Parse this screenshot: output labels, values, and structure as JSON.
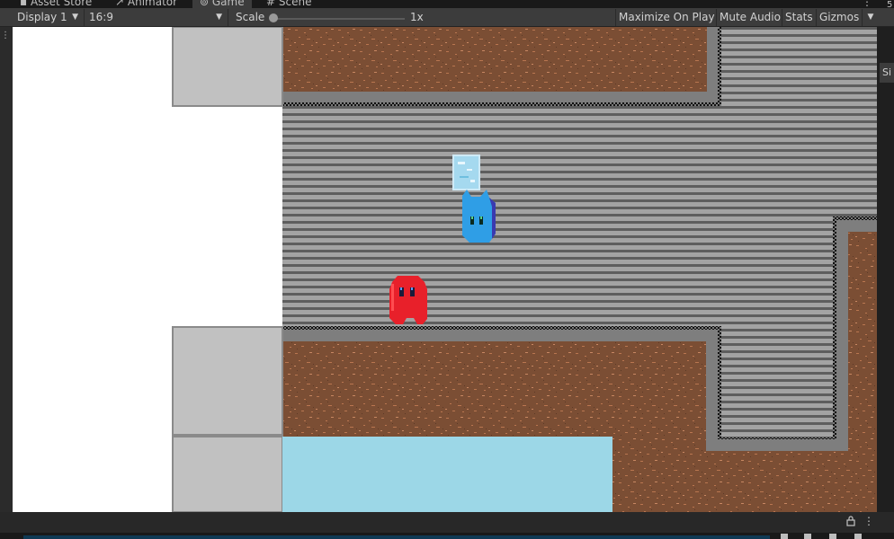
{
  "editor": {
    "tabs": [
      {
        "label": "Asset Store",
        "icon": "asset-store-icon"
      },
      {
        "label": "Animator",
        "icon": "animator-icon"
      },
      {
        "label": "Game",
        "icon": "game-controller-icon",
        "active": true
      },
      {
        "label": "Scene",
        "icon": "scene-grid-icon"
      }
    ],
    "toolbar": {
      "display": "Display 1",
      "aspect": "16:9",
      "scale_label": "Scale",
      "scale_value": "1x",
      "scale_level": 0.0,
      "maximize_label": "Maximize On Play",
      "mute_label": "Mute Audio",
      "stats_label": "Stats",
      "gizmos_label": "Gizmos"
    },
    "side_tab_label": "Si",
    "colors": {
      "editor_bg": "#191919",
      "toolbar_bg": "#3c3c3c",
      "dirt": "#7b4e34",
      "dirt_speck": "#b97650",
      "stone": "#7e7e7e",
      "stripes_dark": "#5e5e5e",
      "stripes_light": "#a3a3a3",
      "water": "#9cd7e7",
      "block": "#c1c1c1",
      "red_player": "#e8202a",
      "blue_player": "#2f9ee6"
    }
  },
  "game": {
    "characters": [
      {
        "name": "red-blob",
        "color": "#e8202a"
      },
      {
        "name": "blue-cat",
        "color": "#2f9ee6"
      }
    ],
    "pickup": "ice-block"
  }
}
